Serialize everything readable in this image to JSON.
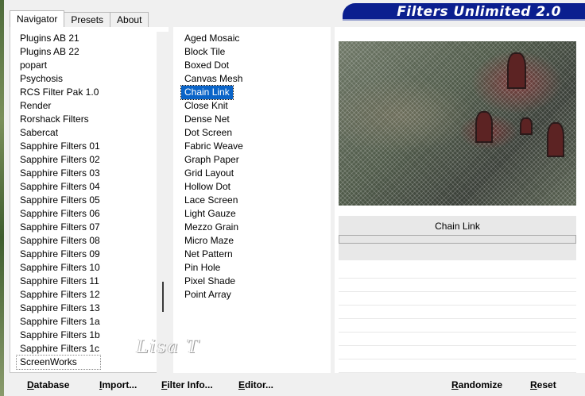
{
  "app": {
    "title": "Filters Unlimited 2.0"
  },
  "tabs": [
    {
      "label": "Navigator",
      "active": true
    },
    {
      "label": "Presets",
      "active": false
    },
    {
      "label": "About",
      "active": false
    }
  ],
  "categories": [
    "Plugins AB 21",
    "Plugins AB 22",
    "popart",
    "Psychosis",
    "RCS Filter Pak 1.0",
    "Render",
    "Rorshack Filters",
    "Sabercat",
    "Sapphire Filters 01",
    "Sapphire Filters 02",
    "Sapphire Filters 03",
    "Sapphire Filters 04",
    "Sapphire Filters 05",
    "Sapphire Filters 06",
    "Sapphire Filters 07",
    "Sapphire Filters 08",
    "Sapphire Filters 09",
    "Sapphire Filters 10",
    "Sapphire Filters 11",
    "Sapphire Filters 12",
    "Sapphire Filters 13",
    "Sapphire Filters 1a",
    "Sapphire Filters 1b",
    "Sapphire Filters 1c",
    "ScreenWorks"
  ],
  "selected_category": "ScreenWorks",
  "filters": [
    "Aged Mosaic",
    "Block Tile",
    "Boxed Dot",
    "Canvas Mesh",
    "Chain Link",
    "Close Knit",
    "Dense Net",
    "Dot Screen",
    "Fabric Weave",
    "Graph Paper",
    "Grid Layout",
    "Hollow Dot",
    "Lace Screen",
    "Light Gauze",
    "Mezzo Grain",
    "Micro Maze",
    "Net Pattern",
    "Pin Hole",
    "Pixel Shade",
    "Point Array"
  ],
  "selected_filter": "Chain Link",
  "info": {
    "filter_name": "Chain Link",
    "progress": 0
  },
  "buttons": {
    "database": {
      "accel": "D",
      "rest": "atabase"
    },
    "import": {
      "accel": "I",
      "rest": "mport..."
    },
    "filter_info": {
      "accel": "F",
      "pre": "",
      "rest": "ilter Info..."
    },
    "editor": {
      "accel": "E",
      "rest": "ditor..."
    },
    "randomize": {
      "accel": "R",
      "rest": "andomize"
    },
    "reset": {
      "accel": "R",
      "rest": "eset"
    }
  },
  "watermark": "Lisa T",
  "colors": {
    "title_banner": "#0b1f8f",
    "selection": "#0a64c8"
  }
}
